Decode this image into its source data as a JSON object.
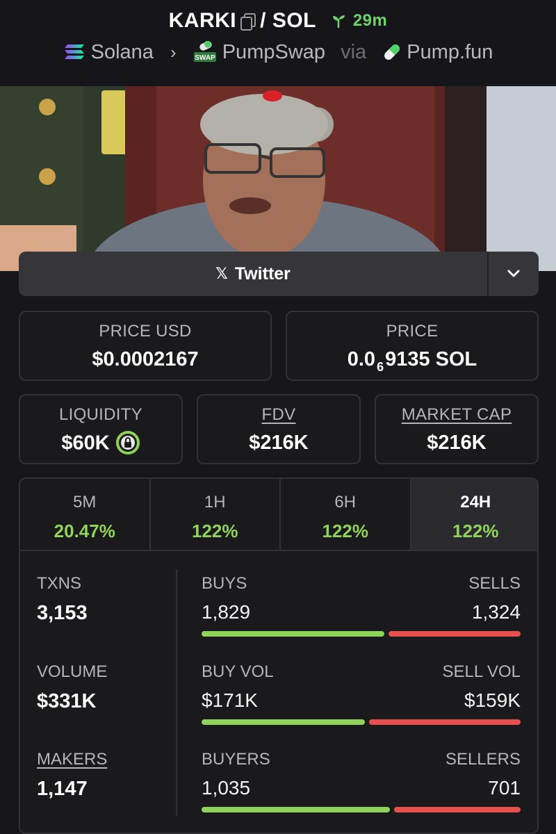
{
  "header": {
    "token": "KARKI",
    "separator": "/",
    "quote": "SOL",
    "age": "29m",
    "chain": "Solana",
    "dex": "PumpSwap",
    "via": "via",
    "launchpad": "Pump.fun",
    "dex_badge": "SWAP"
  },
  "twitter": {
    "label": "Twitter"
  },
  "price_usd": {
    "label": "PRICE USD",
    "value": "$0.0002167"
  },
  "price": {
    "label": "PRICE",
    "prefix": "0.0",
    "sub": "6",
    "suffix": "9135 SOL"
  },
  "liquidity": {
    "label": "LIQUIDITY",
    "value": "$60K"
  },
  "fdv": {
    "label": "FDV",
    "value": "$216K"
  },
  "market_cap": {
    "label": "MARKET CAP",
    "value": "$216K"
  },
  "tabs": [
    {
      "name": "5M",
      "value": "20.47%"
    },
    {
      "name": "1H",
      "value": "122%"
    },
    {
      "name": "6H",
      "value": "122%"
    },
    {
      "name": "24H",
      "value": "122%"
    }
  ],
  "stats": {
    "txns": {
      "label": "TXNS",
      "value": "3,153"
    },
    "volume": {
      "label": "VOLUME",
      "value": "$331K"
    },
    "makers": {
      "label": "MAKERS",
      "value": "1,147"
    },
    "buys": {
      "label": "BUYS",
      "value": "1,829"
    },
    "sells": {
      "label": "SELLS",
      "value": "1,324"
    },
    "buy_vol": {
      "label": "BUY VOL",
      "value": "$171K"
    },
    "sell_vol": {
      "label": "SELL VOL",
      "value": "$159K"
    },
    "buyers": {
      "label": "BUYERS",
      "value": "1,035"
    },
    "sellers": {
      "label": "SELLERS",
      "value": "701"
    }
  },
  "ratios": {
    "buys_fraction": 0.58,
    "buy_vol_fraction": 0.518,
    "buyers_fraction": 0.596
  },
  "colors": {
    "positive": "#8fd35a",
    "negative": "#e8504f",
    "age": "#6ed36a"
  }
}
